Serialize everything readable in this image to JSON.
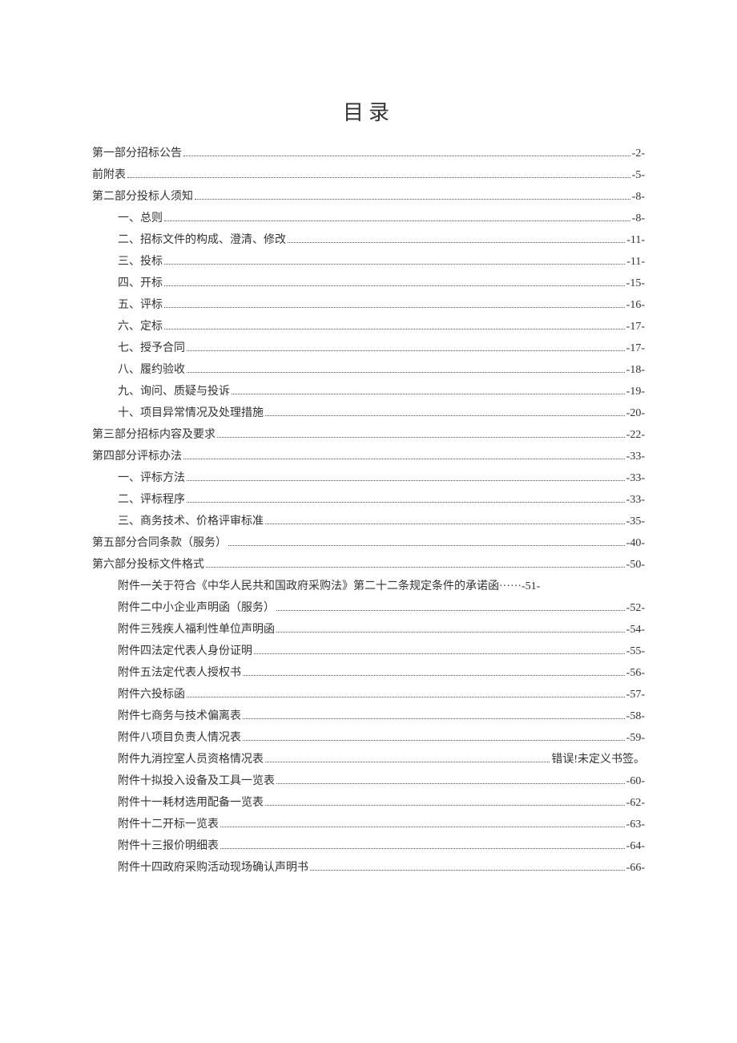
{
  "title": "目录",
  "entries": [
    {
      "label": "第一部分招标公告",
      "page": "-2-",
      "indent": false
    },
    {
      "label": "前附表",
      "page": "-5-",
      "indent": false
    },
    {
      "label": "第二部分投标人须知",
      "page": "-8-",
      "indent": false
    },
    {
      "label": "一、总则",
      "page": "-8-",
      "indent": true
    },
    {
      "label": "二、招标文件的构成、澄清、修改",
      "page": "-11-",
      "indent": true
    },
    {
      "label": "三、投标",
      "page": "-11-",
      "indent": true
    },
    {
      "label": "四、开标",
      "page": "-15-",
      "indent": true
    },
    {
      "label": "五、评标",
      "page": "-16-",
      "indent": true
    },
    {
      "label": "六、定标",
      "page": "-17-",
      "indent": true
    },
    {
      "label": "七、授予合同",
      "page": "-17-",
      "indent": true
    },
    {
      "label": "八、履约验收",
      "page": "-18-",
      "indent": true
    },
    {
      "label": "九、询问、质疑与投诉",
      "page": "-19-",
      "indent": true
    },
    {
      "label": "十、项目异常情况及处理措施",
      "page": "-20-",
      "indent": true
    },
    {
      "label": "第三部分招标内容及要求",
      "page": "-22-",
      "indent": false
    },
    {
      "label": "第四部分评标办法",
      "page": "-33-",
      "indent": false
    },
    {
      "label": "一、评标方法",
      "page": "-33-",
      "indent": true
    },
    {
      "label": "二、评标程序",
      "page": "-33-",
      "indent": true
    },
    {
      "label": "三、商务技术、价格评审标准",
      "page": "-35-",
      "indent": true
    },
    {
      "label": "第五部分合同条款（服务）",
      "page": "-40-",
      "indent": false
    },
    {
      "label": "第六部分投标文件格式",
      "page": "-50-",
      "indent": false
    },
    {
      "label": "附件一关于符合《中华人民共和国政府采购法》第二十二条规定条件的承诺函······-51-",
      "page": "",
      "indent": true,
      "nodots": true
    },
    {
      "label": "附件二中小企业声明函（服务）",
      "page": "-52-",
      "indent": true
    },
    {
      "label": "附件三残疾人福利性单位声明函",
      "page": "-54-",
      "indent": true
    },
    {
      "label": "附件四法定代表人身份证明",
      "page": "-55-",
      "indent": true
    },
    {
      "label": "附件五法定代表人授权书",
      "page": "-56-",
      "indent": true
    },
    {
      "label": "附件六投标函",
      "page": "-57-",
      "indent": true
    },
    {
      "label": "附件七商务与技术偏离表",
      "page": "-58-",
      "indent": true
    },
    {
      "label": "附件八项目负责人情况表",
      "page": "-59-",
      "indent": true
    },
    {
      "label": "附件九消控室人员资格情况表",
      "page": "错误!未定义书签。",
      "indent": true,
      "error": true
    },
    {
      "label": "附件十拟投入设备及工具一览表",
      "page": "-60-",
      "indent": true
    },
    {
      "label": "附件十一耗材选用配备一览表",
      "page": "-62-",
      "indent": true
    },
    {
      "label": "附件十二开标一览表",
      "page": "-63-",
      "indent": true
    },
    {
      "label": "附件十三报价明细表",
      "page": "-64-",
      "indent": true
    },
    {
      "label": "附件十四政府采购活动现场确认声明书",
      "page": "-66-",
      "indent": true
    }
  ]
}
